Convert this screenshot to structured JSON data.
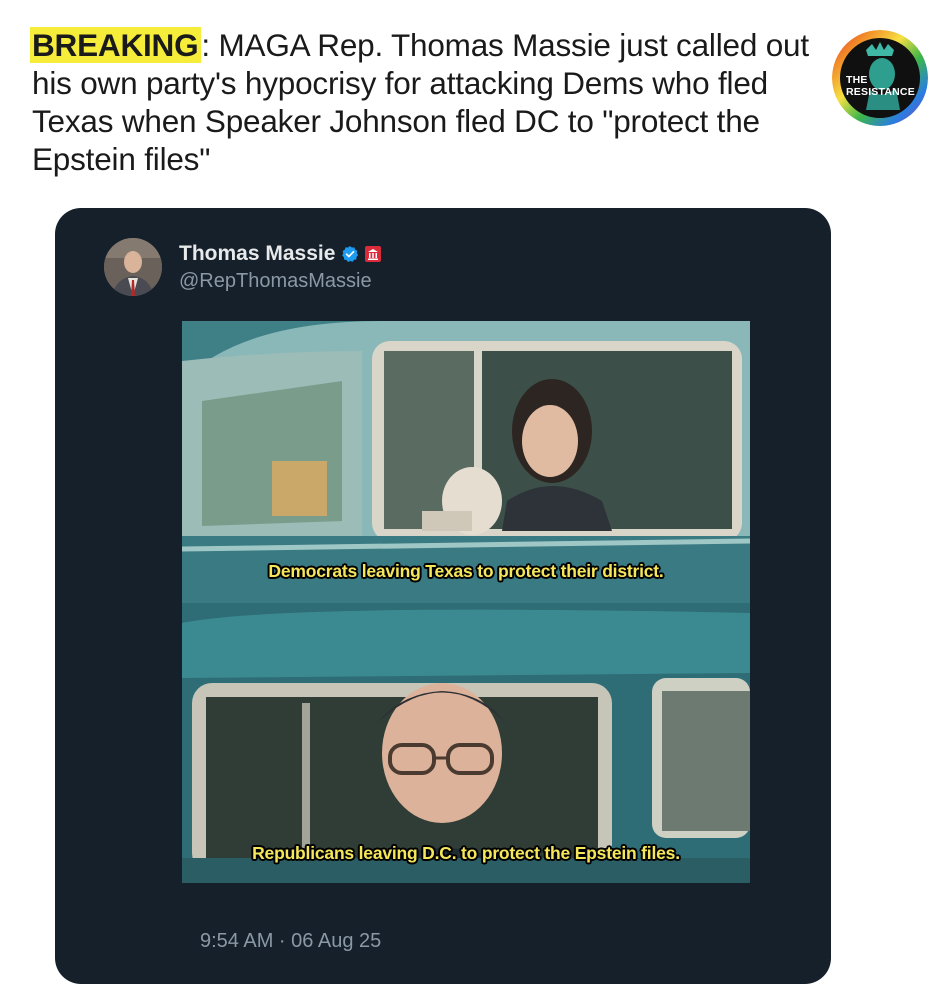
{
  "headline": {
    "tag": "BREAKING",
    "text": ": MAGA Rep. Thomas Massie just called out his own party's hypocrisy for attacking Dems who fled Texas when Speaker Johnson fled DC to \"protect the Epstein files\""
  },
  "logo": {
    "line1": "THE",
    "line2": "RESISTANCE"
  },
  "tweet": {
    "author_name": "Thomas Massie",
    "handle": "@RepThomasMassie",
    "timestamp": "9:54 AM · 06 Aug 25",
    "verified_icon": "verified-badge-icon",
    "affiliation_icon": "us-government-icon"
  },
  "meme": {
    "top_caption": "Democrats leaving Texas to protect their district.",
    "bottom_caption": "Republicans leaving D.C. to protect the Epstein files."
  },
  "colors": {
    "highlight": "#f6ec3a",
    "card_background": "#15202b",
    "caption_text": "#f5e65a",
    "verified": "#1d9bf0"
  }
}
